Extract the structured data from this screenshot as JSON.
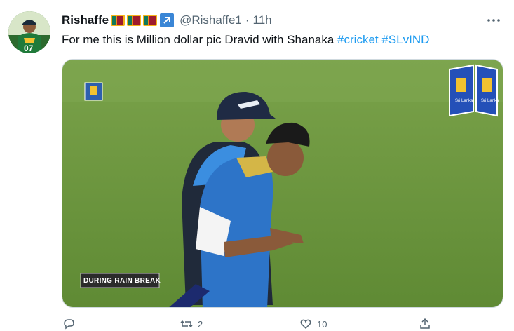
{
  "tweet": {
    "display_name": "Rishaffe",
    "handle": "@Rishaffe1",
    "separator": "·",
    "time": "11h",
    "more_icon": "more-horizontal-icon",
    "text_plain": "For me this is Million dollar pic Dravid with Shanaka ",
    "hashtags": [
      "#cricket",
      "#SLvIND"
    ]
  },
  "media": {
    "caption": "DURING RAIN BREAK",
    "logo_text": "Sri Lanka Cricket"
  },
  "actions": {
    "reply_icon": "reply-icon",
    "retweet_icon": "retweet-icon",
    "retweet_count": "2",
    "like_icon": "heart-icon",
    "like_count": "10",
    "share_icon": "share-icon"
  },
  "colors": {
    "accent": "#1d9bf0",
    "field": "#6f9a3f",
    "jersey": "#2d74c8"
  }
}
